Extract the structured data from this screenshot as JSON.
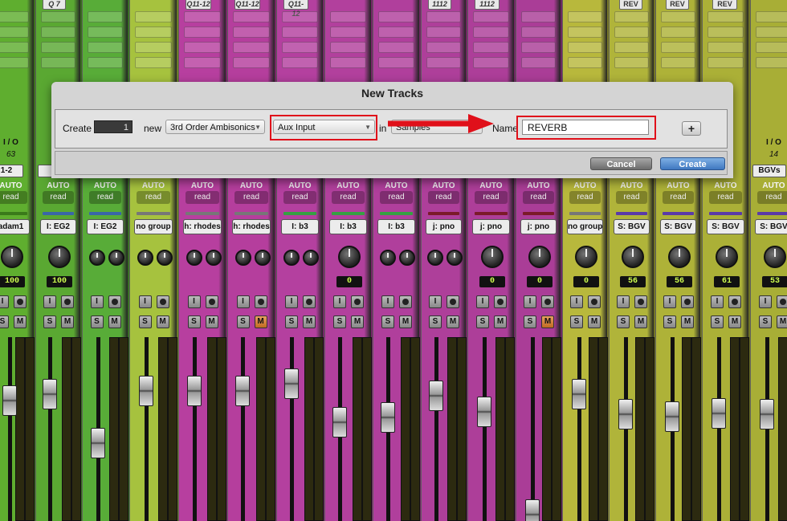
{
  "strips": [
    {
      "top": "",
      "io": "I / O",
      "ioval": "63",
      "sel": "1-2",
      "group": "adam1",
      "pan": [
        "100"
      ],
      "mute_on": false
    },
    {
      "top": "Q 7",
      "io": "",
      "ioval": "",
      "sel": "1",
      "group": "I: EG2",
      "pan": [
        "100"
      ],
      "mute_on": false
    },
    {
      "top": "",
      "io": "",
      "ioval": "",
      "sel": "",
      "group": "I: EG2",
      "pan": [],
      "mute_on": false
    },
    {
      "top": "",
      "io": "",
      "ioval": "",
      "sel": "",
      "group": "no group",
      "pan": [],
      "mute_on": false
    },
    {
      "top": "Q11-12",
      "io": "",
      "ioval": "",
      "sel": "",
      "group": "h: rhodes",
      "pan": [],
      "mute_on": false
    },
    {
      "top": "Q11-12",
      "io": "",
      "ioval": "",
      "sel": "",
      "group": "h: rhodes",
      "pan": [],
      "mute_on": true
    },
    {
      "top": "Q11-12",
      "io": "",
      "ioval": "",
      "sel": "",
      "group": "I: b3",
      "pan": [],
      "mute_on": false
    },
    {
      "top": "",
      "io": "",
      "ioval": "",
      "sel": "",
      "group": "I: b3",
      "pan": [
        "0"
      ],
      "mute_on": false
    },
    {
      "top": "",
      "io": "",
      "ioval": "",
      "sel": "",
      "group": "I: b3",
      "pan": [],
      "mute_on": false
    },
    {
      "top": "1112",
      "io": "",
      "ioval": "",
      "sel": "",
      "group": "j: pno",
      "pan": [],
      "mute_on": false
    },
    {
      "top": "1112",
      "io": "",
      "ioval": "",
      "sel": "",
      "group": "j: pno",
      "pan": [
        "0"
      ],
      "mute_on": false
    },
    {
      "top": "",
      "io": "",
      "ioval": "",
      "sel": "",
      "group": "j: pno",
      "pan": [
        "0"
      ],
      "mute_on": true
    },
    {
      "top": "",
      "io": "",
      "ioval": "",
      "sel": "",
      "group": "no group",
      "pan": [
        "0"
      ],
      "mute_on": false
    },
    {
      "top": "REV",
      "io": "",
      "ioval": "",
      "sel": "",
      "group": "S: BGV",
      "pan": [
        "56"
      ],
      "mute_on": false
    },
    {
      "top": "REV",
      "io": "",
      "ioval": "",
      "sel": "",
      "group": "S: BGV",
      "pan": [
        "56"
      ],
      "mute_on": false
    },
    {
      "top": "REV",
      "io": "",
      "ioval": "",
      "sel": "",
      "group": "S: BGV",
      "pan": [
        "61"
      ],
      "mute_on": false
    },
    {
      "top": "",
      "io": "I / O",
      "ioval": "14",
      "sel": "BGVs",
      "group": "S: BGV",
      "pan": [
        "53"
      ],
      "mute_on": false
    }
  ],
  "automation_label": "AUTO",
  "read_label": "read",
  "input_btn": "I",
  "solo_btn": "S",
  "mute_btn": "M",
  "dialog": {
    "title": "New Tracks",
    "create_label": "Create",
    "count": "1",
    "new_label": "new",
    "format": "3rd Order Ambisonics",
    "track_type": "Aux Input",
    "in_label": "in",
    "timebase": "Samples",
    "name_label": "Name",
    "name_value": "REVERB",
    "plus": "+",
    "cancel": "Cancel",
    "create": "Create"
  },
  "colors": {
    "green": "#5fae2f",
    "lime": "#9fc23a",
    "magenta": "#b83fa0",
    "olive": "#b2b53a",
    "highlight": "#e0101a"
  }
}
